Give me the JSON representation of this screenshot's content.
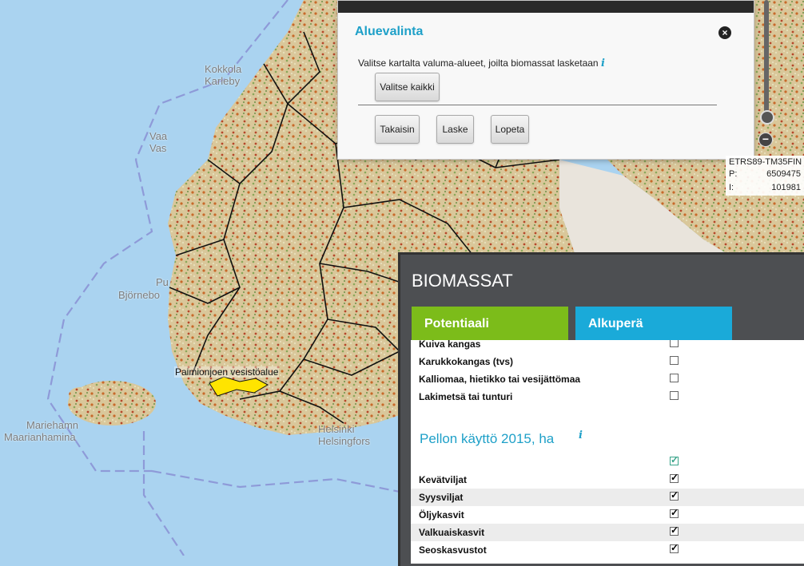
{
  "map": {
    "places": [
      {
        "text": "Kokkola",
        "id": "kokkola"
      },
      {
        "text": "Karleby",
        "id": "karleby"
      },
      {
        "text": "Vaa",
        "id": "vaasa"
      },
      {
        "text": "Vas",
        "id": "vasa"
      },
      {
        "text": "Pu",
        "id": "pori"
      },
      {
        "text": "Björnebo",
        "id": "bjorneborg"
      },
      {
        "text": "Mariehamn",
        "id": "mariehamn"
      },
      {
        "text": "Maarianhamina",
        "id": "maarianhamina"
      },
      {
        "text": "Helsinki",
        "id": "helsinki"
      },
      {
        "text": "Helsingfors",
        "id": "helsingfors"
      }
    ],
    "selected_area_label": "Paimionjoen vesistöalue"
  },
  "dialog": {
    "title": "Aluevalinta",
    "instruction": "Valitse kartalta valuma-alueet, joilta biomassat lasketaan",
    "info_icon": "i",
    "select_all": "Valitse kaikki",
    "back": "Takaisin",
    "calculate": "Laske",
    "stop": "Lopeta",
    "close_symbol": "×"
  },
  "zoom": {
    "minus_symbol": "−"
  },
  "coordinates": {
    "system": "ETRS89-TM35FIN",
    "p_label": "P:",
    "p_value": "6509475",
    "i_label": "I:",
    "i_value": "101981"
  },
  "panel": {
    "title": "BIOMASSAT",
    "tabs": [
      {
        "label": "Potentiaali",
        "color": "#7cbc1a",
        "active": true
      },
      {
        "label": "Alkuperä",
        "color": "#1aaad9",
        "active": false
      }
    ],
    "land_rows": [
      {
        "label": "Kuiva kangas",
        "checked": false
      },
      {
        "label": "Karukkokangas (tvs)",
        "checked": false
      },
      {
        "label": "Kalliomaa, hietikko tai vesijättömaa",
        "checked": false
      },
      {
        "label": "Lakimetsä tai tunturi",
        "checked": false
      }
    ],
    "field_section": {
      "title": "Pellon käyttö 2015, ha",
      "info_icon": "i",
      "select_all_checked": true,
      "rows": [
        {
          "label": "Kevätviljat",
          "checked": true
        },
        {
          "label": "Syysviljat",
          "checked": true
        },
        {
          "label": "Öljykasvit",
          "checked": true
        },
        {
          "label": "Valkuaiskasvit",
          "checked": true
        },
        {
          "label": "Seoskasvustot",
          "checked": true
        }
      ]
    }
  },
  "colors": {
    "sea": "#aad3f0",
    "land": "#e9e4dc",
    "accent": "#1ea0c8",
    "highlight": "#ffe400"
  }
}
